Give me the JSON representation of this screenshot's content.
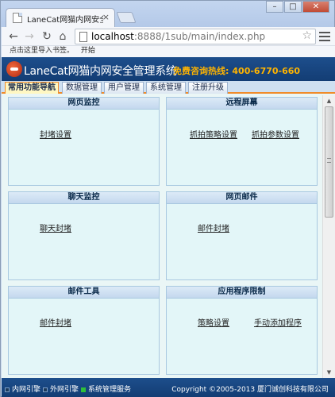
{
  "browser": {
    "tab_title": "LaneCat网猫内网安全管理",
    "url_host": "localhost",
    "url_path": ":8888/1sub/main/index.php",
    "bookmarks_hint": "点击这里导入书签。",
    "bookmarks_import": "开始"
  },
  "header": {
    "logo_text": "LaneCat网猫内网安全管理系统",
    "hotline_label": "免费咨询热线:",
    "hotline_number": "400-6770-660"
  },
  "nav_tabs": [
    {
      "label": "常用功能导航",
      "active": true
    },
    {
      "label": "数据管理"
    },
    {
      "label": "用户管理"
    },
    {
      "label": "系统管理"
    },
    {
      "label": "注册升级"
    }
  ],
  "panels": [
    {
      "title": "网页监控",
      "links": [
        "封堵设置"
      ]
    },
    {
      "title": "远程屏幕",
      "links": [
        "抓拍策略设置",
        "抓拍参数设置"
      ]
    },
    {
      "title": "聊天监控",
      "links": [
        "聊天封堵"
      ]
    },
    {
      "title": "网页邮件",
      "links": [
        "邮件封堵"
      ]
    },
    {
      "title": "邮件工具",
      "links": [
        "邮件封堵"
      ]
    },
    {
      "title": "应用程序限制",
      "links": [
        "策略设置",
        "手动添加程序"
      ]
    }
  ],
  "footer": {
    "status_1": "内网引擎",
    "status_2": "外网引擎",
    "status_3": "系统管理服务",
    "copyright": "Copyright ©2005-2013 厦门诚创科技有限公司"
  },
  "colors": {
    "header_bg": "#1d4e8c",
    "hotline": "#ffb400",
    "active_tab_border": "#f08b2a",
    "status_1": "#1b3a5c",
    "status_2": "#1b3a5c",
    "status_3": "#2fbf3a"
  }
}
